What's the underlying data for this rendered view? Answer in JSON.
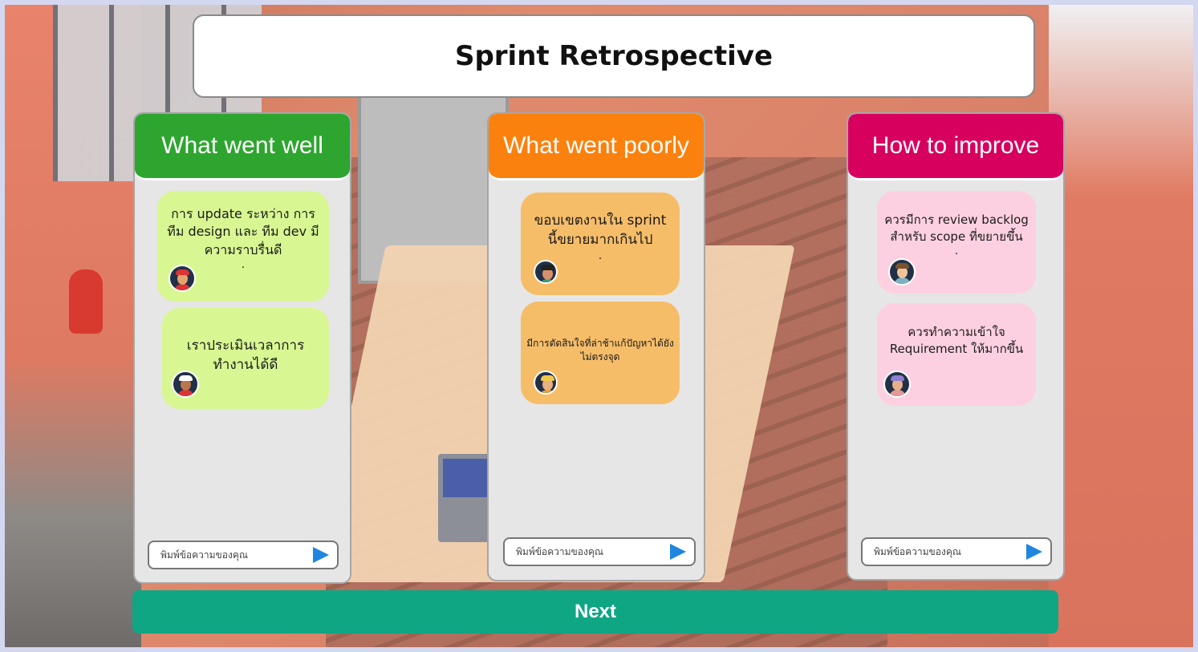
{
  "title": "Sprint Retrospective",
  "colors": {
    "well": "#2ea52f",
    "poorly": "#fb810e",
    "improve": "#d8005f",
    "next": "#0fa684"
  },
  "columns": [
    {
      "header": "What went well",
      "cards": [
        {
          "text": "การ update ระหว่าง การทีม design และ ทีม dev มีความราบรื่นดี",
          "dot": "."
        },
        {
          "text": "เราประเมินเวลาการทำงานได้ดี",
          "dot": ""
        }
      ],
      "input_placeholder": "พิมพ์ข้อความของคุณ"
    },
    {
      "header": "What went poorly",
      "cards": [
        {
          "text": "ขอบเขตงานใน sprint นี้ขยายมากเกินไป",
          "dot": "."
        },
        {
          "text": "มีการตัดสินใจที่ล่าช้าแก้ปัญหาได้ยังไม่ตรงจุด",
          "dot": ""
        }
      ],
      "input_placeholder": "พิมพ์ข้อความของคุณ"
    },
    {
      "header": "How to improve",
      "cards": [
        {
          "text": "ควรมีการ review backlog สำหรับ scope ที่ขยายขึ้น",
          "dot": "."
        },
        {
          "text": "ควรทำความเข้าใจ Requirement ให้มากขึ้น",
          "dot": ""
        }
      ],
      "input_placeholder": "พิมพ์ข้อความของคุณ"
    }
  ],
  "next_label": "Next"
}
